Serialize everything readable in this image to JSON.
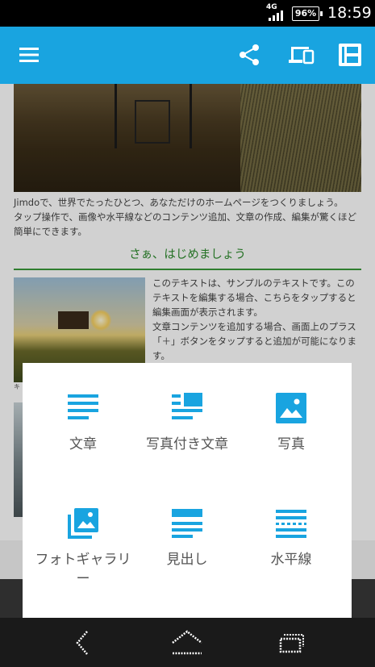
{
  "status_bar": {
    "network": "4G",
    "battery": "96%",
    "time": "18:59"
  },
  "app_bar": {
    "icons": [
      "menu-icon",
      "share-icon",
      "devices-icon",
      "layout-icon"
    ],
    "color": "#19a4e0"
  },
  "page": {
    "intro_line1": "Jimdoで、世界でたったひとつ、あなただけのホームページをつくりましょう。",
    "intro_line2": "タップ操作で、画像や水平線などのコンテンツ追加、文章の作成、編集が驚くほど簡単にできます。",
    "section_title": "さぁ、はじめましょう",
    "body1": "このテキストは、サンプルのテキストです。このテキストを編集する場合、こちらをタップすると編集画面が表示されます。",
    "body2": "文章コンテンツを追加する場合、画面上のプラス「＋」ボタンをタップすると追加が可能になります。",
    "caption1": "キ",
    "accent_green": "#2e8b2e"
  },
  "add_content_menu": {
    "items": [
      {
        "label": "文章",
        "icon": "text-icon"
      },
      {
        "label": "写真付き文章",
        "icon": "text-with-photo-icon"
      },
      {
        "label": "写真",
        "icon": "photo-icon"
      },
      {
        "label": "フォトギャラリー",
        "icon": "photo-gallery-icon"
      },
      {
        "label": "見出し",
        "icon": "heading-icon"
      },
      {
        "label": "水平線",
        "icon": "horizontal-line-icon"
      }
    ],
    "icon_color": "#19a4e0"
  },
  "nav_bar": {
    "buttons": [
      "back-icon",
      "home-icon",
      "recent-apps-icon"
    ]
  }
}
